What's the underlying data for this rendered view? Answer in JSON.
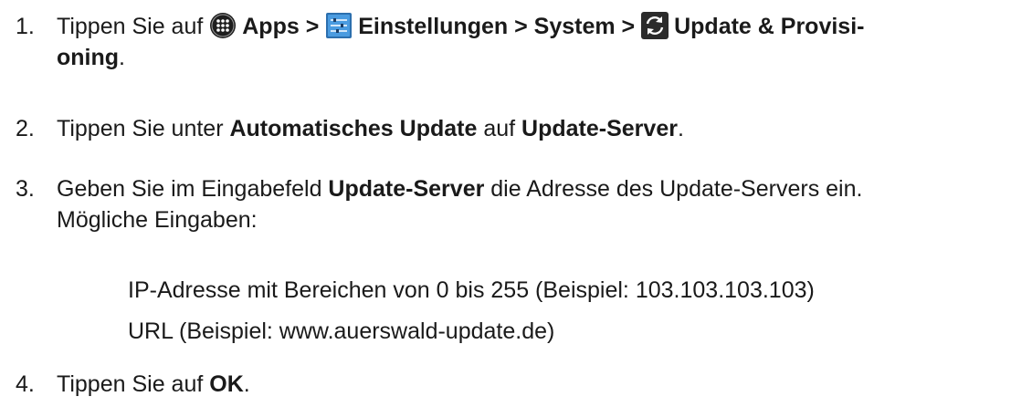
{
  "steps": [
    {
      "number": "1.",
      "prefix": "Tippen Sie auf",
      "apps_icon": "apps-icon",
      "apps_label": "Apps >",
      "settings_icon": "settings-icon",
      "settings_label": "Einstellungen > System >",
      "update_icon": "update-sync-icon",
      "update_label_line1": "Update & Provisi-",
      "update_label_line2": "oning",
      "suffix": "."
    },
    {
      "number": "2.",
      "text1": "Tippen Sie unter",
      "bold1": "Automatisches Update",
      "text2": "auf",
      "bold2": "Update-Server",
      "suffix": "."
    },
    {
      "number": "3.",
      "text1": "Geben Sie im Eingabefeld",
      "bold1": "Update-Server",
      "text2": "die Adresse des Update-Servers ein.",
      "line2": "Mögliche Eingaben:",
      "options": [
        "IP-Adresse mit Bereichen von 0 bis 255 (Beispiel: 103.103.103.103)",
        "URL (Beispiel: www.auerswald-update.de)"
      ]
    },
    {
      "number": "4.",
      "text1": "Tippen Sie auf",
      "bold1": "OK",
      "suffix": "."
    }
  ],
  "colors": {
    "text": "#1a1a1a",
    "icon_dark": "#2b2b2b",
    "settings_blue": "#3f8fd2"
  }
}
